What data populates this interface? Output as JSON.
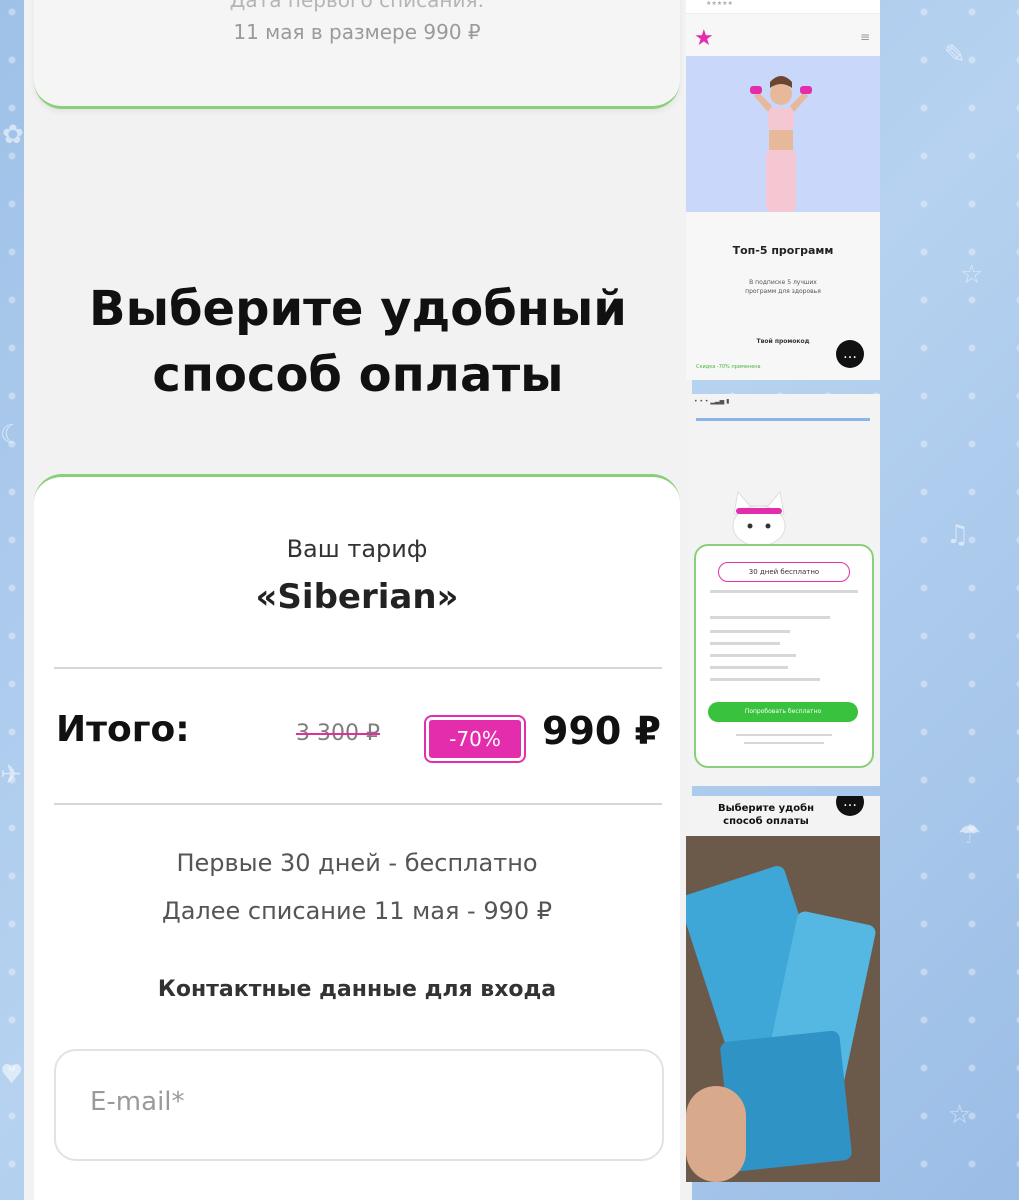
{
  "top_card": {
    "line1": "Дата первого списания:",
    "line2": "11 мая в размере 990 ₽"
  },
  "headline": {
    "line1": "Выберите удобный",
    "line2": "способ оплаты"
  },
  "tariff": {
    "label": "Ваш тариф",
    "name": "«Siberian»"
  },
  "total": {
    "label": "Итого:",
    "old_price": "3 300 ₽",
    "discount": "-70%",
    "new_price": "990 ₽"
  },
  "info": {
    "line1": "Первые 30 дней - бесплатно",
    "line2": "Далее списание 11 мая - 990 ₽"
  },
  "contact": {
    "label": "Контактные данные для входа",
    "email_placeholder": "E-mail*",
    "email_value": ""
  },
  "thumbnails": {
    "t1_title": "Топ-5 программ",
    "t1_sub_line1": "В подписке 5 лучших",
    "t1_sub_line2": "программ для здоровья",
    "t1_promo": "Твой промокод",
    "t1_bar": "Скидка -70% применена",
    "t2_pill": "30 дней бесплатно",
    "t2_button": "Попробовать бесплатно",
    "t3_title_line1": "Выберите удобн",
    "t3_title_line2": "способ оплаты"
  },
  "colors": {
    "accent_green": "#8ad07a",
    "accent_pink": "#e32dad",
    "button_green": "#39c23d",
    "background_blue": "#a9c8ea"
  }
}
